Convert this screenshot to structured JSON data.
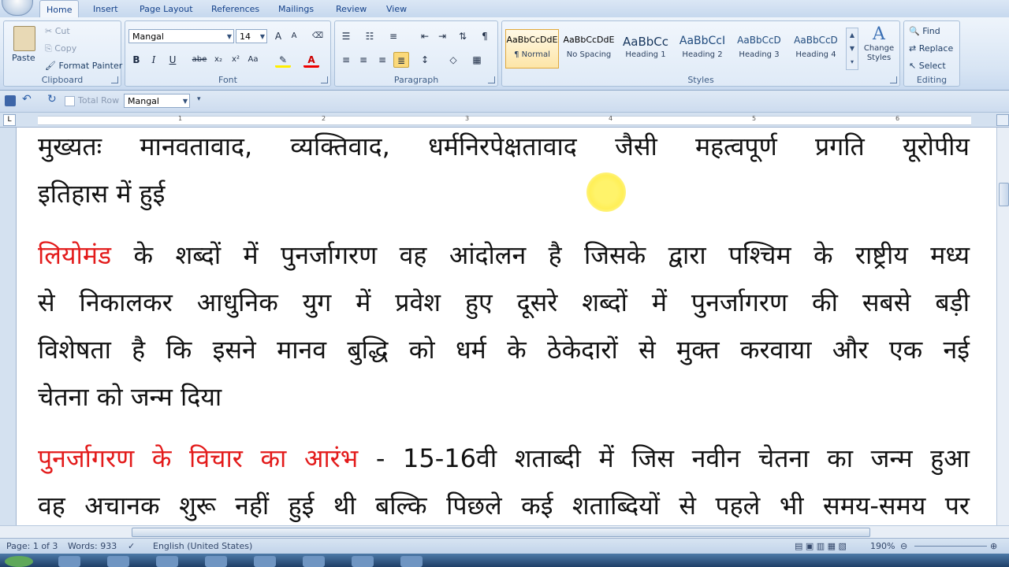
{
  "tabs": [
    "Home",
    "Insert",
    "Page Layout",
    "References",
    "Mailings",
    "Review",
    "View"
  ],
  "clipboard": {
    "label": "Clipboard",
    "paste": "Paste",
    "cut": "Cut",
    "copy": "Copy",
    "format_painter": "Format Painter"
  },
  "font": {
    "label": "Font",
    "name": "Mangal",
    "size": "14",
    "bold": "B",
    "italic": "I",
    "underline": "U",
    "strike": "abe",
    "sub": "x₂",
    "sup": "x²",
    "change_case": "Aa",
    "grow": "A",
    "shrink": "A"
  },
  "paragraph": {
    "label": "Paragraph",
    "pilcrow": "¶"
  },
  "styles": {
    "label": "Styles",
    "items": [
      {
        "sample": "AaBbCcDdE",
        "name": "¶ Normal"
      },
      {
        "sample": "AaBbCcDdE",
        "name": "No Spacing"
      },
      {
        "sample": "AaBbCc",
        "name": "Heading 1"
      },
      {
        "sample": "AaBbCcI",
        "name": "Heading 2"
      },
      {
        "sample": "AaBbCcD",
        "name": "Heading 3"
      },
      {
        "sample": "AaBbCcD",
        "name": "Heading 4"
      }
    ],
    "change_styles": "Change Styles"
  },
  "editing": {
    "label": "Editing",
    "find": "Find",
    "replace": "Replace",
    "select": "Select"
  },
  "qat": {
    "total_row": "Total Row",
    "font": "Mangal"
  },
  "ruler_numbers": [
    "1",
    "2",
    "3",
    "4",
    "5",
    "6"
  ],
  "document": {
    "line1": "मुख्यतः मानवतावाद, व्यक्तिवाद, धर्मनिरपेक्षतावाद जैसी महत्वपूर्ण प्रगति यूरोपीय",
    "line2": "इतिहास में हुई",
    "para2_lead": "लियोमंड",
    "para2_line1": " के शब्दों में पुनर्जागरण वह आंदोलन है जिसके द्वारा पश्चिम के राष्ट्रीय मध्य",
    "para2_line2": "से निकालकर आधुनिक युग में प्रवेश हुए दूसरे शब्दों में  पुनर्जागरण की सबसे बड़ी",
    "para2_line3": "विशेषता है कि इसने मानव बुद्धि को धर्म के ठेकेदारों से मुक्त करवाया और एक नई",
    "para2_line4": "चेतना को जन्म दिया",
    "para3_lead": "पुनर्जागरण के विचार का आरंभ",
    "para3_line1": " - 15-16वी शताब्दी में जिस नवीन चेतना का जन्म हुआ",
    "para3_line2": "वह अचानक शुरू नहीं हुई थी बल्कि पिछले कई शताब्दियों से पहले भी समय-समय पर"
  },
  "status": {
    "page": "Page: 1 of 3",
    "words": "Words: 933",
    "language": "English (United States)",
    "zoom": "190%"
  },
  "colors": {
    "accent_red": "#e31b1b",
    "ribbon_blue": "#15428b"
  }
}
